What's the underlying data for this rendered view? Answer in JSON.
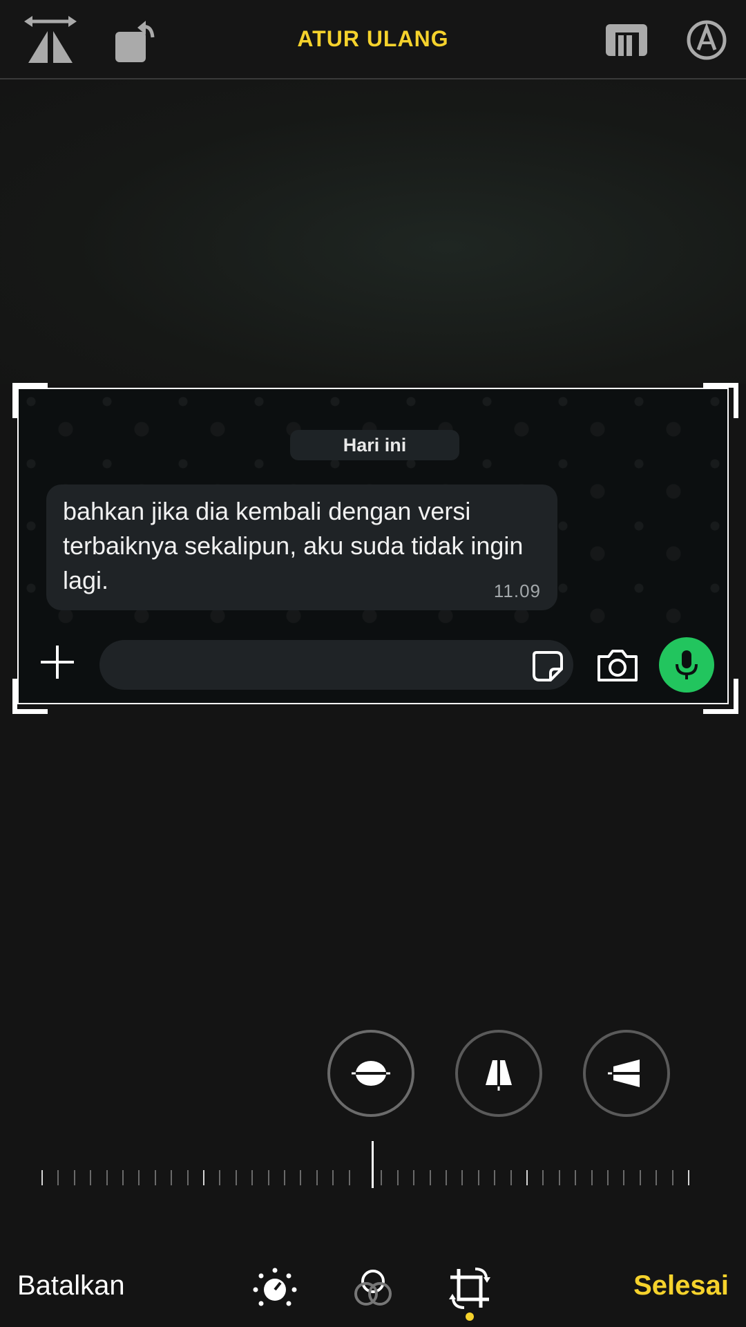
{
  "toolbar": {
    "reset_label": "ATUR ULANG",
    "icons": [
      "flip-icon",
      "rotate-icon",
      "aspect-ratio-icon",
      "markup-icon"
    ]
  },
  "chat": {
    "date_label": "Hari ini",
    "message_text": "bahkan jika dia kembali dengan versi terbaiknya sekalipun, aku suda tidak ingin lagi.",
    "message_time": "11.09",
    "input_icons": [
      "plus-icon",
      "sticker-icon",
      "camera-icon",
      "microphone-icon"
    ]
  },
  "adjust_tools": [
    "straighten-icon",
    "vertical-perspective-icon",
    "horizontal-perspective-icon"
  ],
  "bottom": {
    "cancel_label": "Batalkan",
    "done_label": "Selesai",
    "tabs": [
      "adjust-icon",
      "filters-icon",
      "crop-icon"
    ],
    "active_tab": "crop-icon"
  },
  "colors": {
    "accent": "#f5d22c",
    "mic_green": "#22c55e",
    "background": "#141414"
  }
}
